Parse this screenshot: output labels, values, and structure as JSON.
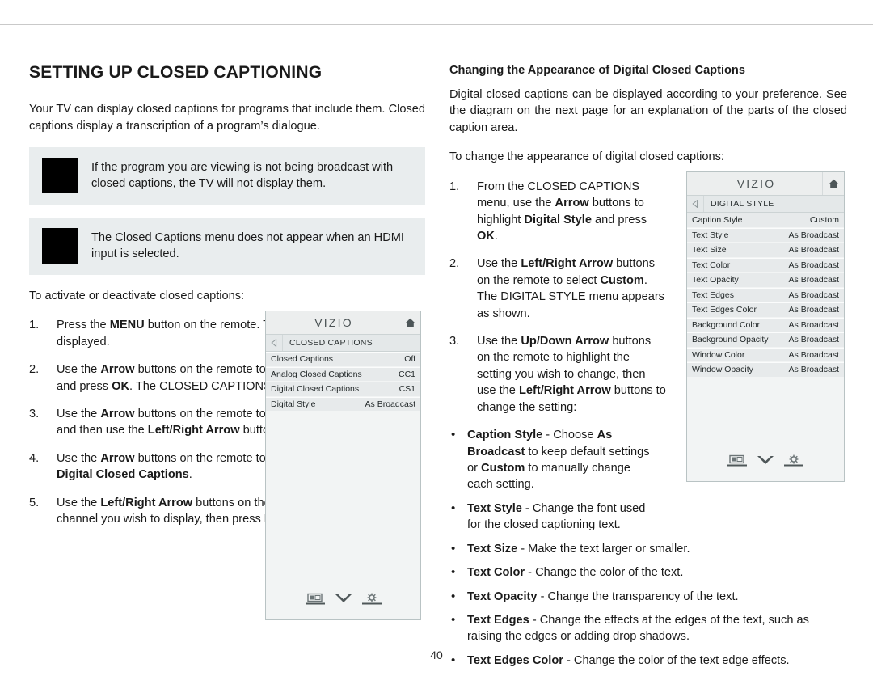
{
  "page": {
    "number": "40"
  },
  "left": {
    "title": "SETTING UP CLOSED CAPTIONING",
    "intro": "Your TV can display closed captions for programs that include them. Closed captions display a transcription of a program’s dialogue.",
    "notes": [
      "If the program you are viewing is not being broadcast with closed captions, the TV will not display them.",
      "The Closed Captions menu does not appear when an HDMI input is selected."
    ],
    "lead_in": "To activate or deactivate closed captions:",
    "steps": [
      {
        "num": "1.",
        "html": "Press the <b>MENU</b> button on the remote. The on-screen menu is displayed."
      },
      {
        "num": "2.",
        "html": "Use the <b>Arrow</b> buttons on the remote to highlight <b>Closed Captions</b> and press <b>OK</b>. The CLOSED CAPTIONS menu is displayed."
      },
      {
        "num": "3.",
        "html": "Use the <b>Arrow</b> buttons on the remote to highlight <b>Closed Captions</b> and then use the <b>Left/Right Arrow</b> buttons to select <b>On</b> or <b>Off</b>."
      },
      {
        "num": "4.",
        "html": "Use the <b>Arrow</b> buttons on the remote to highlight either <b>Analog</b> or <b>Digital Closed Captions</b>."
      },
      {
        "num": "5.",
        "html": "Use the <b>Left/Right Arrow</b> buttons on the remote to select the caption channel you wish to display, then press <b>EXIT</b>."
      }
    ]
  },
  "right": {
    "heading": "Changing the Appearance of Digital Closed Captions",
    "intro": "Digital closed captions can be displayed according to your preference. See the diagram on the next page for an explanation of the parts of the closed caption area.",
    "lead_in": "To change the appearance of digital closed captions:",
    "steps": [
      {
        "num": "1.",
        "html": "From the CLOSED CAPTIONS menu, use the <b>Arrow</b> buttons to highlight <b>Digital Style</b> and press <b>OK</b>."
      },
      {
        "num": "2.",
        "html": "Use the <b>Left/Right Arrow</b> buttons on the remote to select <b>Custom</b>. The DIGITAL STYLE menu appears as shown."
      },
      {
        "num": "3.",
        "html": "Use the <b>Up/Down Arrow</b> buttons on the remote to highlight the setting you wish to change, then use the <b>Left/Right Arrow</b> buttons to change the setting:"
      }
    ],
    "bullets_narrow": [
      {
        "html": "<b>Caption Style</b> - Choose <b>As Broadcast</b> to keep default settings or <b>Custom</b> to manually change each setting."
      },
      {
        "html": "<b>Text Style</b>  - Change the font used for the closed captioning text."
      }
    ],
    "bullets_wide": [
      {
        "html": "<b>Text Size</b> - Make the text larger or smaller."
      },
      {
        "html": "<b>Text Color</b> - Change the color of the text."
      },
      {
        "html": "<b>Text Opacity</b> - Change the transparency of the text."
      },
      {
        "html": "<b>Text Edges</b> - Change the effects at the edges of the text, such as raising the edges or adding drop shadows."
      },
      {
        "html": "<b>Text Edges Color</b> - Change the color of the text edge effects."
      }
    ]
  },
  "tv_menu_closed_captions": {
    "brand": "VIZIO",
    "breadcrumb": "CLOSED CAPTIONS",
    "rows": [
      {
        "label": "Closed Captions",
        "value": "Off"
      },
      {
        "label": "Analog Closed Captions",
        "value": "CC1"
      },
      {
        "label": "Digital Closed Captions",
        "value": "CS1"
      },
      {
        "label": "Digital Style",
        "value": "As Broadcast"
      }
    ]
  },
  "tv_menu_digital_style": {
    "brand": "VIZIO",
    "breadcrumb": "DIGITAL STYLE",
    "rows": [
      {
        "label": "Caption Style",
        "value": "Custom"
      },
      {
        "label": "Text Style",
        "value": "As Broadcast"
      },
      {
        "label": "Text Size",
        "value": "As Broadcast"
      },
      {
        "label": "Text Color",
        "value": "As Broadcast"
      },
      {
        "label": "Text Opacity",
        "value": "As Broadcast"
      },
      {
        "label": "Text Edges",
        "value": "As Broadcast"
      },
      {
        "label": "Text Edges Color",
        "value": "As Broadcast"
      },
      {
        "label": "Background Color",
        "value": "As Broadcast"
      },
      {
        "label": "Background Opacity",
        "value": "As Broadcast"
      },
      {
        "label": "Window Color",
        "value": "As Broadcast"
      },
      {
        "label": "Window Opacity",
        "value": "As Broadcast"
      }
    ]
  },
  "icons": {
    "home": "home-icon",
    "back": "back-arrow-icon",
    "picture": "picture-mode-icon",
    "chevrons_down": "double-chevron-down-icon",
    "settings": "gear-icon",
    "bullet": "•"
  },
  "colors": {
    "note_background": "#e9edee",
    "panel_background": "#f2f4f4",
    "panel_border": "#b9c3c4",
    "row_background": "#e7eaeb",
    "logo_text": "#4a5254"
  }
}
